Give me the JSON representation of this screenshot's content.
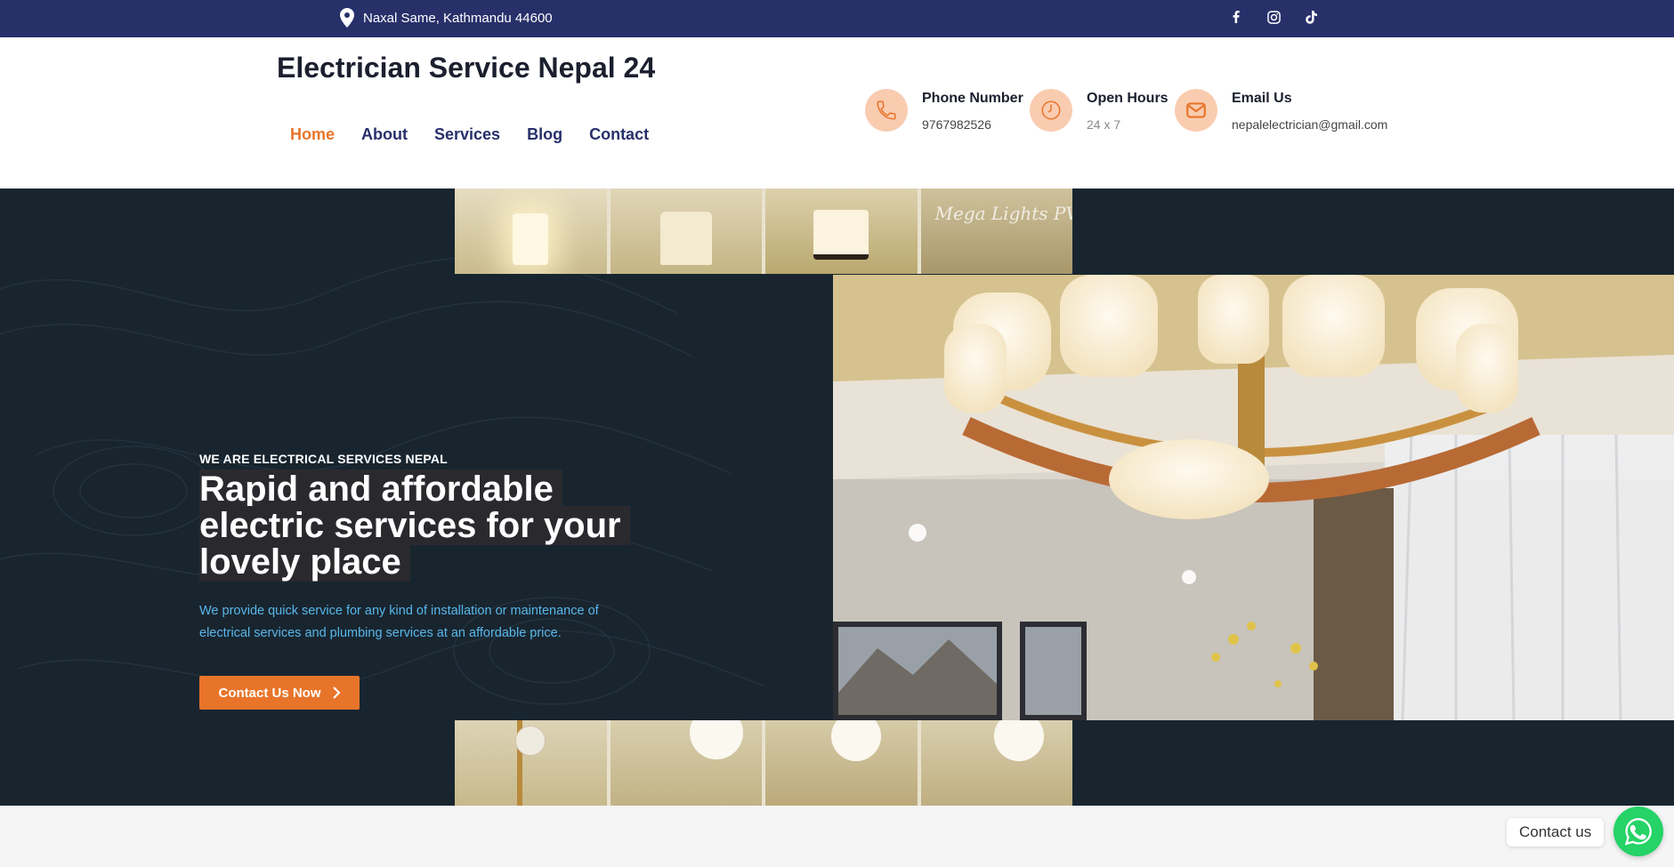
{
  "topbar": {
    "location": "Naxal Same, Kathmandu 44600",
    "icons": [
      "map-pin-icon",
      "facebook-icon",
      "instagram-icon",
      "tiktok-icon"
    ]
  },
  "header": {
    "site_title": "Electrician Service Nepal 24",
    "nav": [
      {
        "label": "Home",
        "active": true
      },
      {
        "label": "About",
        "active": false
      },
      {
        "label": "Services",
        "active": false
      },
      {
        "label": "Blog",
        "active": false
      },
      {
        "label": "Contact",
        "active": false
      }
    ],
    "info": {
      "phone": {
        "title": "Phone Number",
        "value": "9767982526"
      },
      "hours": {
        "title": "Open Hours",
        "value": "24 x 7"
      },
      "email": {
        "title": "Email Us",
        "value": "nepalelectrician@gmail.com"
      }
    }
  },
  "hero": {
    "eyebrow": "WE ARE ELECTRICAL SERVICES NEPAL",
    "headline": "Rapid and affordable electric services for your lovely place",
    "description": "We provide quick service for any kind of installation or maintenance of electrical services and plumbing services at an affordable price.",
    "cta_label": "Contact Us Now",
    "watermark": "Mega Lights PVT LTD"
  },
  "chat_widget": {
    "label": "Contact us"
  },
  "colors": {
    "topbar": "#28306a",
    "accent": "#e8742a",
    "hero_bg": "#18252f",
    "link_blue": "#59b7ea",
    "whatsapp": "#25d366"
  }
}
